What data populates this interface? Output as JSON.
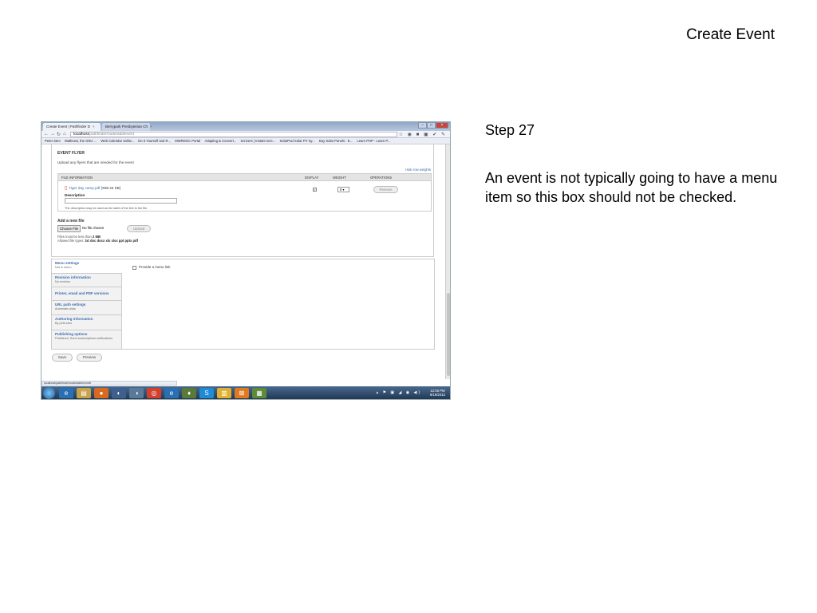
{
  "slide": {
    "title": "Create Event",
    "step": "Step 27",
    "instruction": "An event is not typically going to have a menu item so this box should not be checked."
  },
  "browser": {
    "tabs": [
      {
        "label": "Create Event | Pathfinder D"
      },
      {
        "label": "Berrypark Presbyterian Ch"
      }
    ],
    "url_host": "localhost",
    "url_path": "/pathfinder/node/add/event",
    "bookmarks": [
      "Peter Steo",
      "Mathews, the GNU ...",
      "Web Calendar Softw...",
      "Do It Yourself and R...",
      "MWRDGC Portal",
      "Adapting & Convert...",
      "Scrivers | Instant scre...",
      "SolarPod Solar PV Sy...",
      "Buy Solar Panels - E...",
      "Learn PHP - Learn P..."
    ],
    "status_url": "localhost/pathfinder/node/add/event#"
  },
  "form": {
    "flyer_heading": "EVENT FLYER",
    "flyer_desc": "Upload any flyers that are needed for the event",
    "hide_row_weights": "Hide row weights",
    "table_headers": [
      "FILE INFORMATION",
      "DISPLAY",
      "WEIGHT",
      "OPERATIONS"
    ],
    "file_name": "Tiger day camp.pdf",
    "file_size": "(938.43 KB)",
    "description_label": "Description",
    "description_help": "The description may be used as the label of the link to the file.",
    "weight_value": "0",
    "remove_label": "Remove",
    "add_new_file": "Add a new file",
    "choose_file": "Choose File",
    "no_file": "No file chosen",
    "upload_label": "Upload",
    "size_note_prefix": "Files must be less than ",
    "size_limit": "2 MB",
    "types_note_prefix": "Allowed file types: ",
    "file_types": "txt doc docx xls xlsx ppt pptx pdf",
    "vertical_tabs": [
      {
        "title": "Menu settings",
        "summary": "Not in menu"
      },
      {
        "title": "Revision information",
        "summary": "No revision"
      },
      {
        "title": "Printer, email and PDF versions",
        "summary": ""
      },
      {
        "title": "URL path settings",
        "summary": "Automatic alias"
      },
      {
        "title": "Authoring information",
        "summary": "By pete.steo"
      },
      {
        "title": "Publishing options",
        "summary": "Published, Send subscriptions notifications"
      }
    ],
    "menu_link_label": "Provide a menu link",
    "save_label": "Save",
    "preview_label": "Preview"
  },
  "taskbar": {
    "time": "12:06 PM",
    "date": "9/19/2012"
  }
}
